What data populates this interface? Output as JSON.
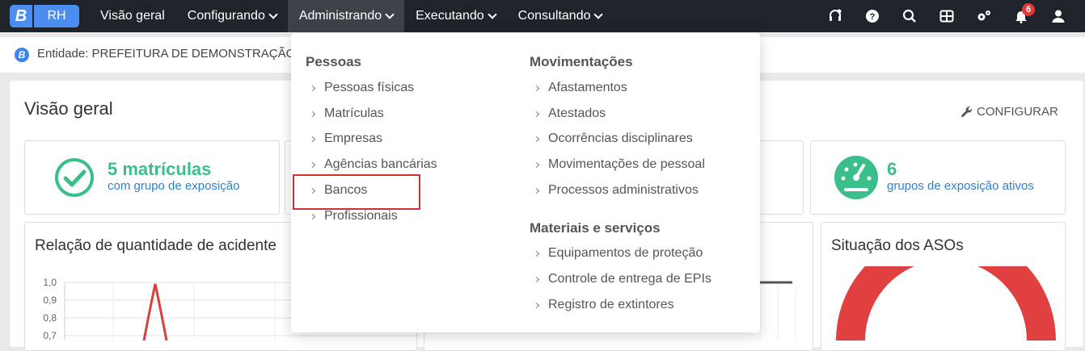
{
  "logo": {
    "letter": "B",
    "app": "RH"
  },
  "nav": [
    {
      "label": "Visão geral",
      "dropdown": false
    },
    {
      "label": "Configurando",
      "dropdown": true
    },
    {
      "label": "Administrando",
      "dropdown": true,
      "active": true
    },
    {
      "label": "Executando",
      "dropdown": true
    },
    {
      "label": "Consultando",
      "dropdown": true
    }
  ],
  "topicons": {
    "notifications_count": "6",
    "icons": [
      "headset-icon",
      "help-icon",
      "search-icon",
      "apps-grid-icon",
      "settings-icon",
      "bell-icon",
      "user-icon"
    ]
  },
  "entity": {
    "icon_letter": "B",
    "text": "Entidade: PREFEITURA DE DEMONSTRAÇÃO"
  },
  "page": {
    "title": "Visão geral",
    "configure_label": "CONFIGURAR"
  },
  "stats": [
    {
      "value": "5 matrículas",
      "label": "com grupo de exposição"
    },
    {
      "value": "6",
      "label": "grupos de exposição ativos"
    }
  ],
  "charts": {
    "left_title": "Relação de quantidade de acidente",
    "right_title": "Situação dos ASOs",
    "y_ticks": [
      "1,0",
      "0,9",
      "0,8",
      "0,7"
    ]
  },
  "dropdown": {
    "col1": {
      "heading": "Pessoas",
      "items": [
        "Pessoas físicas",
        "Matrículas",
        "Empresas",
        "Agências bancárias",
        "Bancos",
        "Profissionais"
      ]
    },
    "col2": {
      "heading": "Movimentações",
      "items": [
        "Afastamentos",
        "Atestados",
        "Ocorrências disciplinares",
        "Movimentações de pessoal",
        "Processos administrativos"
      ]
    },
    "col3": {
      "heading": "Materiais e serviços",
      "items": [
        "Equipamentos de proteção",
        "Controle de entrega de EPIs",
        "Registro de extintores"
      ]
    }
  },
  "colors": {
    "topbar": "#1e2429",
    "accent": "#4b8df0",
    "green": "#3bbf8a",
    "link": "#2f7fd0",
    "highlight": "#d32f2f",
    "donut": "#e04040"
  }
}
